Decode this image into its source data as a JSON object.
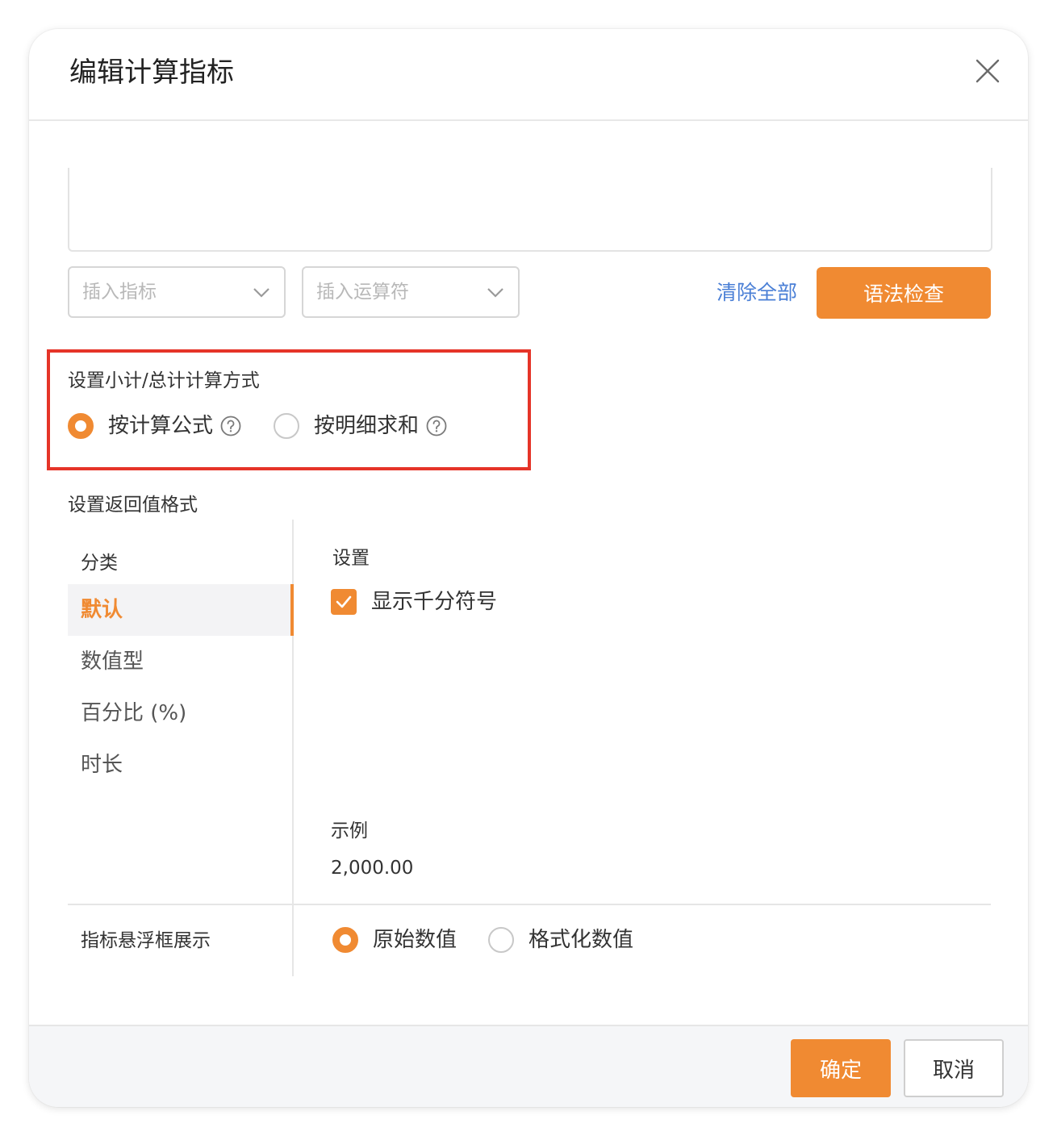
{
  "dialog": {
    "title": "编辑计算指标"
  },
  "toolbar": {
    "insert_metric_placeholder": "插入指标",
    "insert_operator_placeholder": "插入运算符",
    "clear_all": "清除全部",
    "syntax_check": "语法检查"
  },
  "subtotal": {
    "label": "设置小计/总计计算方式",
    "options": [
      {
        "label": "按计算公式",
        "selected": true
      },
      {
        "label": "按明细求和",
        "selected": false
      }
    ]
  },
  "format": {
    "label": "设置返回值格式",
    "category_header": "分类",
    "categories": [
      {
        "label": "默认",
        "active": true
      },
      {
        "label": "数值型",
        "active": false
      },
      {
        "label": "百分比 (%)",
        "active": false
      },
      {
        "label": "时长",
        "active": false
      }
    ],
    "settings_header": "设置",
    "thousands_separator": {
      "label": "显示千分符号",
      "checked": true
    },
    "example_label": "示例",
    "example_value": "2,000.00"
  },
  "tooltip_display": {
    "label": "指标悬浮框展示",
    "options": [
      {
        "label": "原始数值",
        "selected": true
      },
      {
        "label": "格式化数值",
        "selected": false
      }
    ]
  },
  "footer": {
    "ok": "确定",
    "cancel": "取消"
  },
  "colors": {
    "accent": "#f08a32",
    "link": "#4a7fd6",
    "highlight_border": "#e53428"
  }
}
